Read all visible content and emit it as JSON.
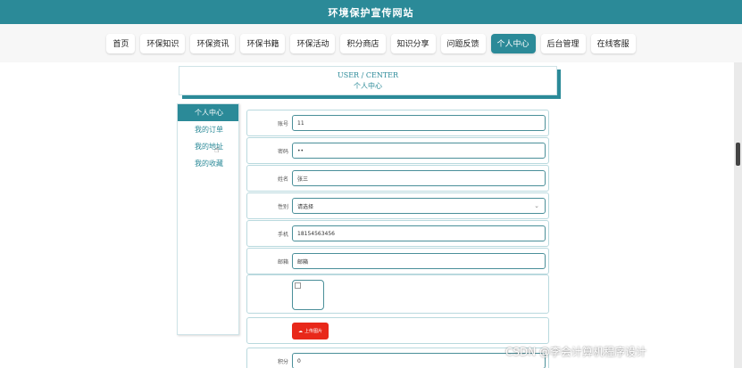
{
  "header": {
    "title": "环境保护宣传网站"
  },
  "nav": {
    "items": [
      {
        "label": "首页",
        "active": false
      },
      {
        "label": "环保知识",
        "active": false
      },
      {
        "label": "环保资讯",
        "active": false
      },
      {
        "label": "环保书籍",
        "active": false
      },
      {
        "label": "环保活动",
        "active": false
      },
      {
        "label": "积分商店",
        "active": false
      },
      {
        "label": "知识分享",
        "active": false
      },
      {
        "label": "问题反馈",
        "active": false
      },
      {
        "label": "个人中心",
        "active": true
      },
      {
        "label": "后台管理",
        "active": false
      },
      {
        "label": "在线客服",
        "active": false
      }
    ]
  },
  "banner": {
    "en": "USER / CENTER",
    "zh": "个人中心"
  },
  "sidebar": {
    "items": [
      {
        "label": "个人中心",
        "active": true
      },
      {
        "label": "我的订单",
        "active": false
      },
      {
        "label": "我的地址",
        "active": false
      },
      {
        "label": "我的收藏",
        "active": false
      }
    ]
  },
  "form": {
    "fields": [
      {
        "label": "账号",
        "value": "11"
      },
      {
        "label": "密码",
        "value": "••"
      },
      {
        "label": "姓名",
        "value": "张三"
      },
      {
        "label": "性别",
        "value": "请选择"
      },
      {
        "label": "手机",
        "value": "18154563456"
      },
      {
        "label": "邮箱",
        "value": "邮箱"
      },
      {
        "label": "积分",
        "value": "0"
      }
    ],
    "upload_label": "上传图片"
  },
  "watermark": "CSDN @李会计算机程序设计",
  "colors": {
    "accent": "#2b8a98",
    "upload": "#e8281a"
  }
}
